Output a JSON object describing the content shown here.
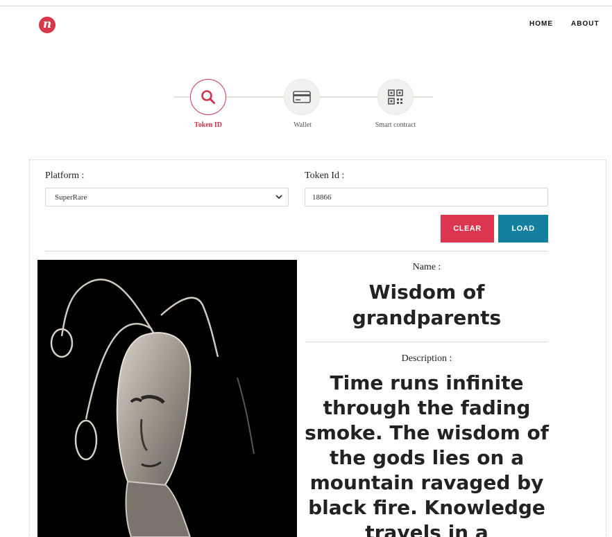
{
  "header": {
    "logo_letter": "n",
    "nav": {
      "home": "HOME",
      "about": "ABOUT"
    }
  },
  "stepper": {
    "steps": [
      {
        "label": "Token ID",
        "icon": "search-icon",
        "active": true
      },
      {
        "label": "Wallet",
        "icon": "credit-card-icon",
        "active": false
      },
      {
        "label": "Smart contract",
        "icon": "qr-code-icon",
        "active": false
      }
    ]
  },
  "form": {
    "platform_label": "Platform :",
    "platform_value": "SuperRare",
    "token_label": "Token Id :",
    "token_value": "18866",
    "clear_label": "CLEAR",
    "load_label": "LOAD"
  },
  "result": {
    "name_label": "Name :",
    "name_value": "Wisdom of grandparents",
    "description_label": "Description :",
    "description_value": "Time runs infinite through the fading smoke. The wisdom of the gods lies on a mountain ravaged by black fire. Knowledge travels in a"
  },
  "colors": {
    "accent_red": "#dc3550",
    "accent_teal": "#12809e",
    "logo": "#d8384c"
  }
}
